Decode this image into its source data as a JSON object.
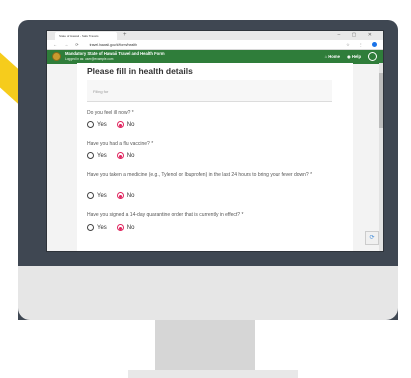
{
  "browser": {
    "tab_title": "State of Hawaii - Safe Travels",
    "new_tab": "+",
    "window_controls": "– ▢ ✕",
    "nav_icons": "← → ⟳",
    "url": "travel.hawaii.gov/#/form/health",
    "right_icons": "☆ ⋮"
  },
  "header": {
    "title": "Mandatory State of Hawaii Travel and Health Form",
    "subtitle": "Logged in as: user@example.com",
    "home": "Home",
    "help": "Help"
  },
  "form": {
    "title": "Please fill in health details",
    "textbox_placeholder": "Filing for",
    "questions": [
      {
        "text": "Do you feel ill now? *",
        "yes": "Yes",
        "no": "No",
        "selected": "No"
      },
      {
        "text": "Have you had a flu vaccine? *",
        "yes": "Yes",
        "no": "No",
        "selected": "No"
      },
      {
        "text": "Have you taken a medicine (e.g., Tylenol or Ibuprofen) in the last 24 hours to bring your fever down? *",
        "yes": "Yes",
        "no": "No",
        "selected": "No"
      },
      {
        "text": "Have you signed a 14-day quarantine order that is currently in effect? *",
        "yes": "Yes",
        "no": "No",
        "selected": "No"
      }
    ]
  },
  "colors": {
    "header_green": "#2f7d3a",
    "radio_selected": "#e0245e",
    "accent_stripe": "#f6cc1c",
    "monitor_frame": "#3f4752"
  }
}
